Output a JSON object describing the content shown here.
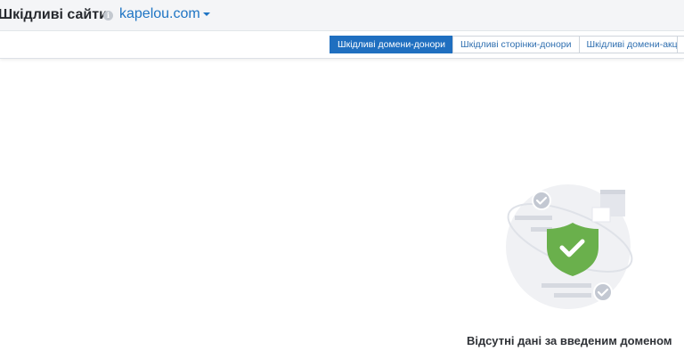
{
  "header": {
    "title": "Шкідливі сайти",
    "info_icon": "i",
    "domain": "kapelou.com"
  },
  "tabs": [
    {
      "label": "Шкідливі домени-донори",
      "active": true
    },
    {
      "label": "Шкідливі сторінки-донори",
      "active": false
    },
    {
      "label": "Шкідливі домени-акцептори",
      "active": false
    }
  ],
  "empty_state": {
    "message": "Відсутні дані за введеним доменом",
    "icon": "shield-check-icon"
  },
  "colors": {
    "accent": "#1f6fc0",
    "link": "#1f75c4",
    "shield": "#6ab04c"
  }
}
